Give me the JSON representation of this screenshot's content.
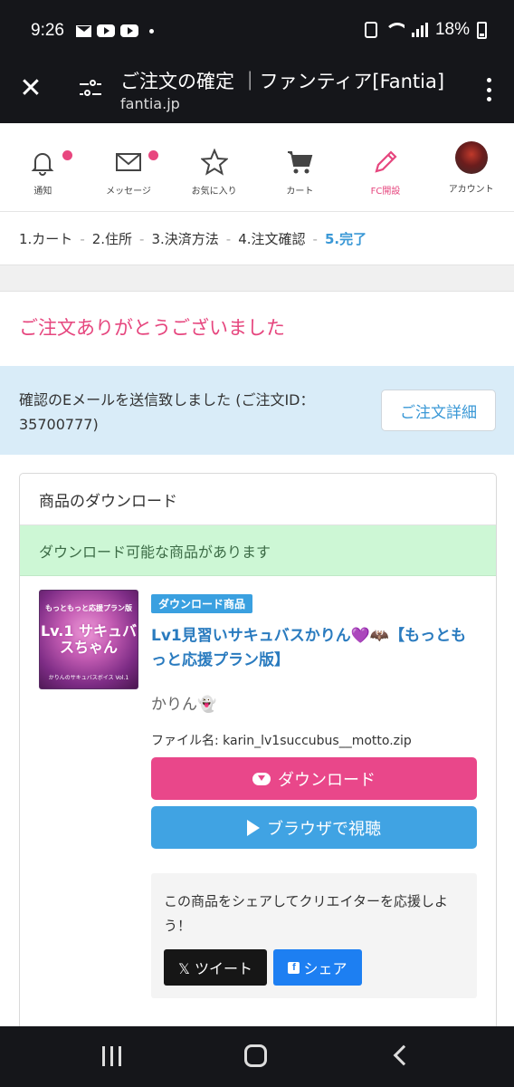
{
  "status_bar": {
    "time": "9:26",
    "battery": "18%"
  },
  "browser": {
    "title": "ご注文の確定 ｜ファンティア[Fantia]",
    "domain": "fantia.jp"
  },
  "nav": {
    "items": [
      {
        "label": "通知",
        "icon": "bell-icon",
        "badge": true
      },
      {
        "label": "メッセージ",
        "icon": "mail-icon",
        "badge": true
      },
      {
        "label": "お気に入り",
        "icon": "star-icon",
        "badge": false
      },
      {
        "label": "カート",
        "icon": "cart-icon",
        "badge": false
      },
      {
        "label": "FC開設",
        "icon": "pencil-icon",
        "badge": false
      },
      {
        "label": "アカウント",
        "icon": "avatar",
        "badge": false
      }
    ],
    "accent_color": "#e8477f"
  },
  "breadcrumb": {
    "steps": [
      "1.カート",
      "2.住所",
      "3.決済方法",
      "4.注文確認",
      "5.完了"
    ],
    "separator": "-",
    "active_color": "#3a98d6"
  },
  "thanks": "ご注文ありがとうございました",
  "info": {
    "text": "確認のEメールを送信致しました (ご注文ID：35700777)",
    "detail_button": "ご注文詳細"
  },
  "download": {
    "header": "商品のダウンロード",
    "alert": "ダウンロード可能な商品があります",
    "thumbnail": {
      "top": "もっともっと応援プラン版",
      "main": "Lv.1 サキュバスちゃん",
      "bottom": "かりんのサキュバスボイス Vol.1"
    },
    "tag": "ダウンロード商品",
    "product_title": "Lv1見習いサキュバスかりん💜🦇【もっともっと応援プラン版】",
    "creator": "かりん👻",
    "filename": "ファイル名: karin_lv1succubus__motto.zip",
    "download_button": "ダウンロード",
    "view_button": "ブラウザで視聴",
    "share_text": "この商品をシェアしてクリエイターを応援しよう！",
    "tweet_button": "𝕏 ツイート",
    "share_button": "シェア"
  }
}
